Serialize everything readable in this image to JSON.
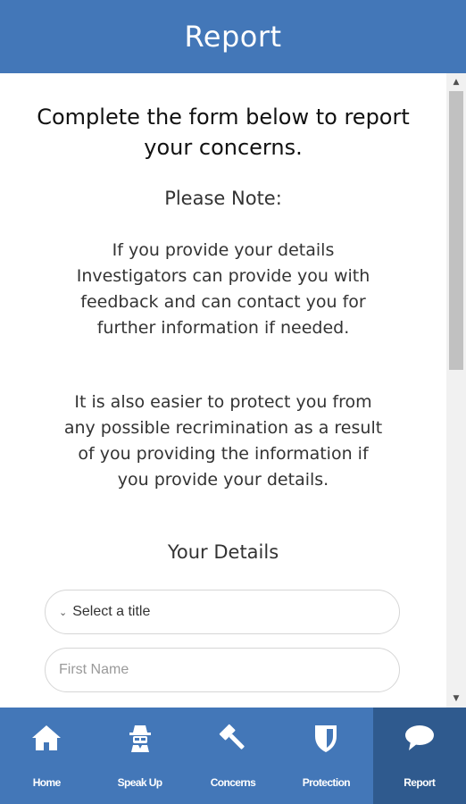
{
  "header": {
    "title": "Report"
  },
  "intro": {
    "heading": "Complete the form below to report your concerns.",
    "note_heading": "Please Note:",
    "paragraph_1": "If you provide your details Investigators can provide you with feedback and can contact you for further information if needed.",
    "paragraph_2": "It is also easier to protect you from any possible recrimination as a result of you providing the information if you provide your details."
  },
  "details": {
    "heading": "Your Details",
    "title_select": {
      "selected": "Select a title"
    },
    "first_name": {
      "placeholder": "First Name",
      "value": ""
    }
  },
  "tabbar": {
    "items": [
      {
        "label": "Home",
        "icon": "home-icon"
      },
      {
        "label": "Speak Up",
        "icon": "spy-icon"
      },
      {
        "label": "Concerns",
        "icon": "gavel-icon"
      },
      {
        "label": "Protection",
        "icon": "shield-icon"
      },
      {
        "label": "Report",
        "icon": "speech-bubble-icon",
        "active": true
      }
    ]
  },
  "colors": {
    "brand": "#4377b8",
    "active_tab": "#2f5a8e"
  }
}
